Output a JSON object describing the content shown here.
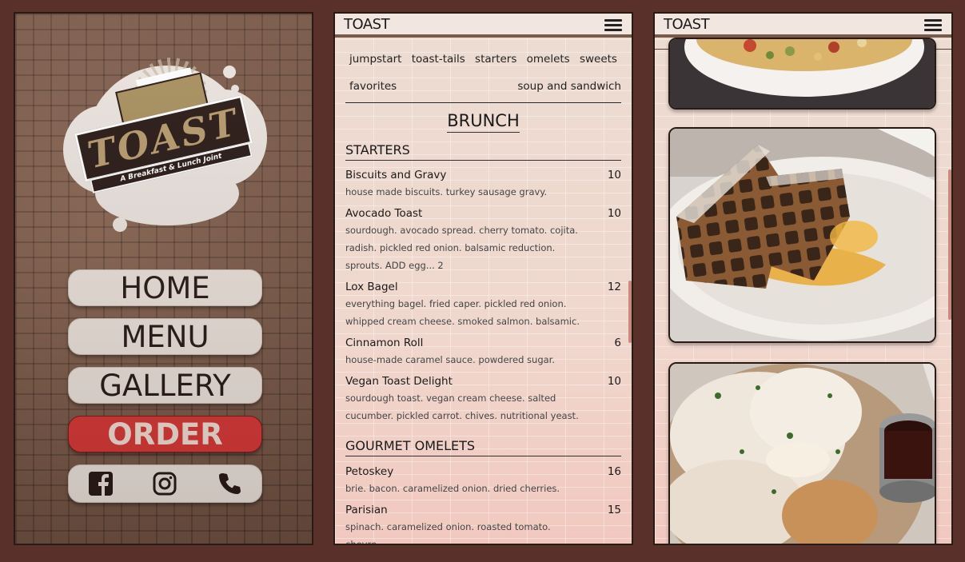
{
  "home": {
    "logo": {
      "name": "TOAST",
      "tagline": "A Breakfast & Lunch Joint"
    },
    "nav": [
      {
        "label": "HOME"
      },
      {
        "label": "MENU"
      },
      {
        "label": "GALLERY"
      },
      {
        "label": "ORDER"
      }
    ],
    "social_icons": [
      "facebook-icon",
      "instagram-icon",
      "phone-icon"
    ]
  },
  "menu_page": {
    "brand": "TOAST",
    "categories_row1": [
      "jumpstart",
      "toast-tails",
      "starters",
      "omelets",
      "sweets"
    ],
    "categories_row2": [
      "favorites",
      "soup and sandwich"
    ],
    "title": "BRUNCH",
    "sections": [
      {
        "heading": "STARTERS",
        "items": [
          {
            "name": "Biscuits and Gravy",
            "price": "10",
            "desc": "house made biscuits. turkey sausage gravy."
          },
          {
            "name": "Avocado Toast",
            "price": "10",
            "desc": "sourdough. avocado spread. cherry tomato. cojita. radish. pickled red onion. balsamic reduction. sprouts. ADD egg... 2"
          },
          {
            "name": "Lox Bagel",
            "price": "12",
            "desc": "everything bagel. fried caper. pickled red onion. whipped cream cheese. smoked salmon. balsamic."
          },
          {
            "name": "Cinnamon Roll",
            "price": "6",
            "desc": "house-made caramel sauce. powdered sugar."
          },
          {
            "name": "Vegan Toast Delight",
            "price": "10",
            "desc": "sourdough toast. vegan cream cheese. salted cucumber. pickled carrot. chives. nutritional yeast."
          }
        ]
      },
      {
        "heading": "GOURMET OMELETS",
        "items": [
          {
            "name": "Petoskey",
            "price": "16",
            "desc": "brie. bacon. caramelized onion. dried cherries."
          },
          {
            "name": "Parisian",
            "price": "15",
            "desc": "spinach. caramelized onion. roasted tomato. chevre."
          }
        ]
      }
    ]
  },
  "gallery_page": {
    "brand": "TOAST",
    "photos": [
      "bowl-photo",
      "waffle-photo",
      "biscuits-gravy-photo"
    ]
  },
  "colors": {
    "background": "#5a302a",
    "order_button": "#d93838",
    "scroll_accent": "#c98a7e"
  }
}
